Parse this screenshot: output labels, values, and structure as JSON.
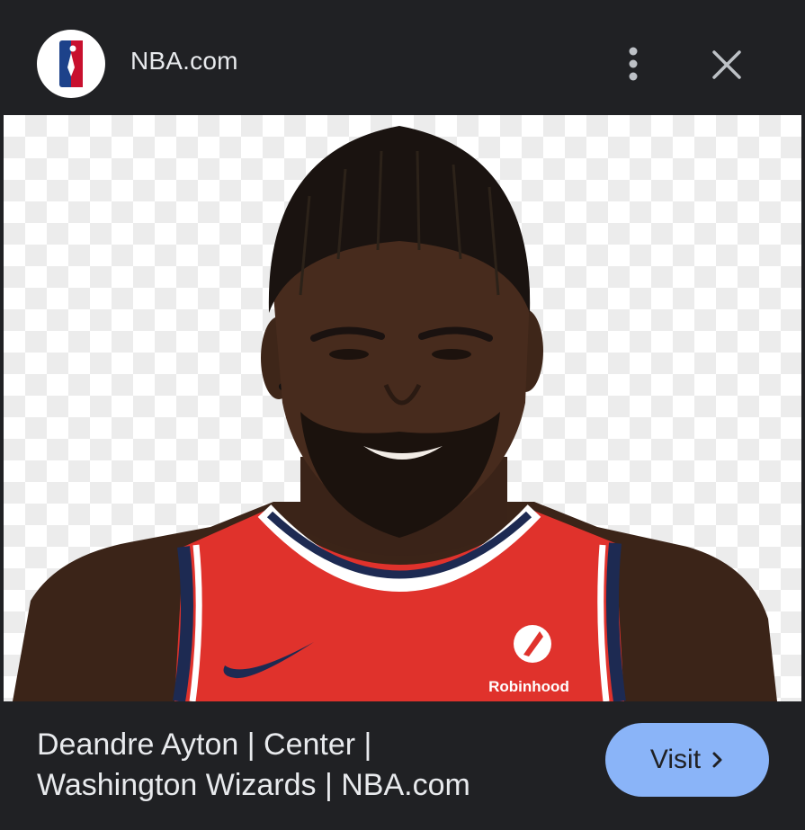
{
  "header": {
    "site_name": "NBA.com",
    "logo_icon": "nba-logo-icon",
    "more_icon": "more-vertical-icon",
    "close_icon": "close-icon"
  },
  "image": {
    "jersey_sponsor": "Robinhood",
    "colors": {
      "jersey_red": "#e0322c",
      "trim_navy": "#1d2a52",
      "trim_white": "#ffffff"
    }
  },
  "caption": {
    "line1": "Deandre Ayton | Center |",
    "line2": "Washington Wizards | NBA.com"
  },
  "visit_button": {
    "label": "Visit",
    "icon": "chevron-right-icon",
    "color": "#8ab4f8"
  }
}
